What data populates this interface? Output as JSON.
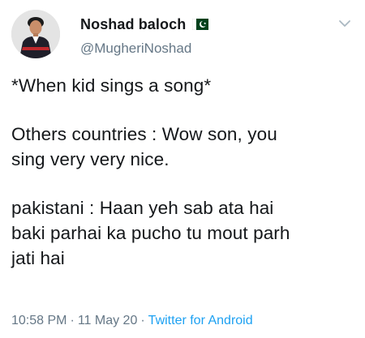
{
  "author": {
    "display_name": "Noshad baloch",
    "handle": "@MugheriNoshad",
    "flag_icon": "pakistan-flag-icon",
    "avatar_icon": "profile-photo"
  },
  "menu_icon": "chevron-down-icon",
  "tweet": {
    "paragraphs": [
      "*When kid sings a song*",
      "Others countries : Wow son, you\nsing very very nice.",
      "pakistani : Haan yeh sab ata hai\nbaki parhai ka pucho tu mout parh\njati hai"
    ]
  },
  "meta": {
    "time": "10:58 PM",
    "separator": "·",
    "date": "11 May 20",
    "source": "Twitter for Android"
  },
  "colors": {
    "text": "#14171a",
    "secondary": "#657786",
    "link": "#1da1f2",
    "flag_green": "#01411c"
  }
}
